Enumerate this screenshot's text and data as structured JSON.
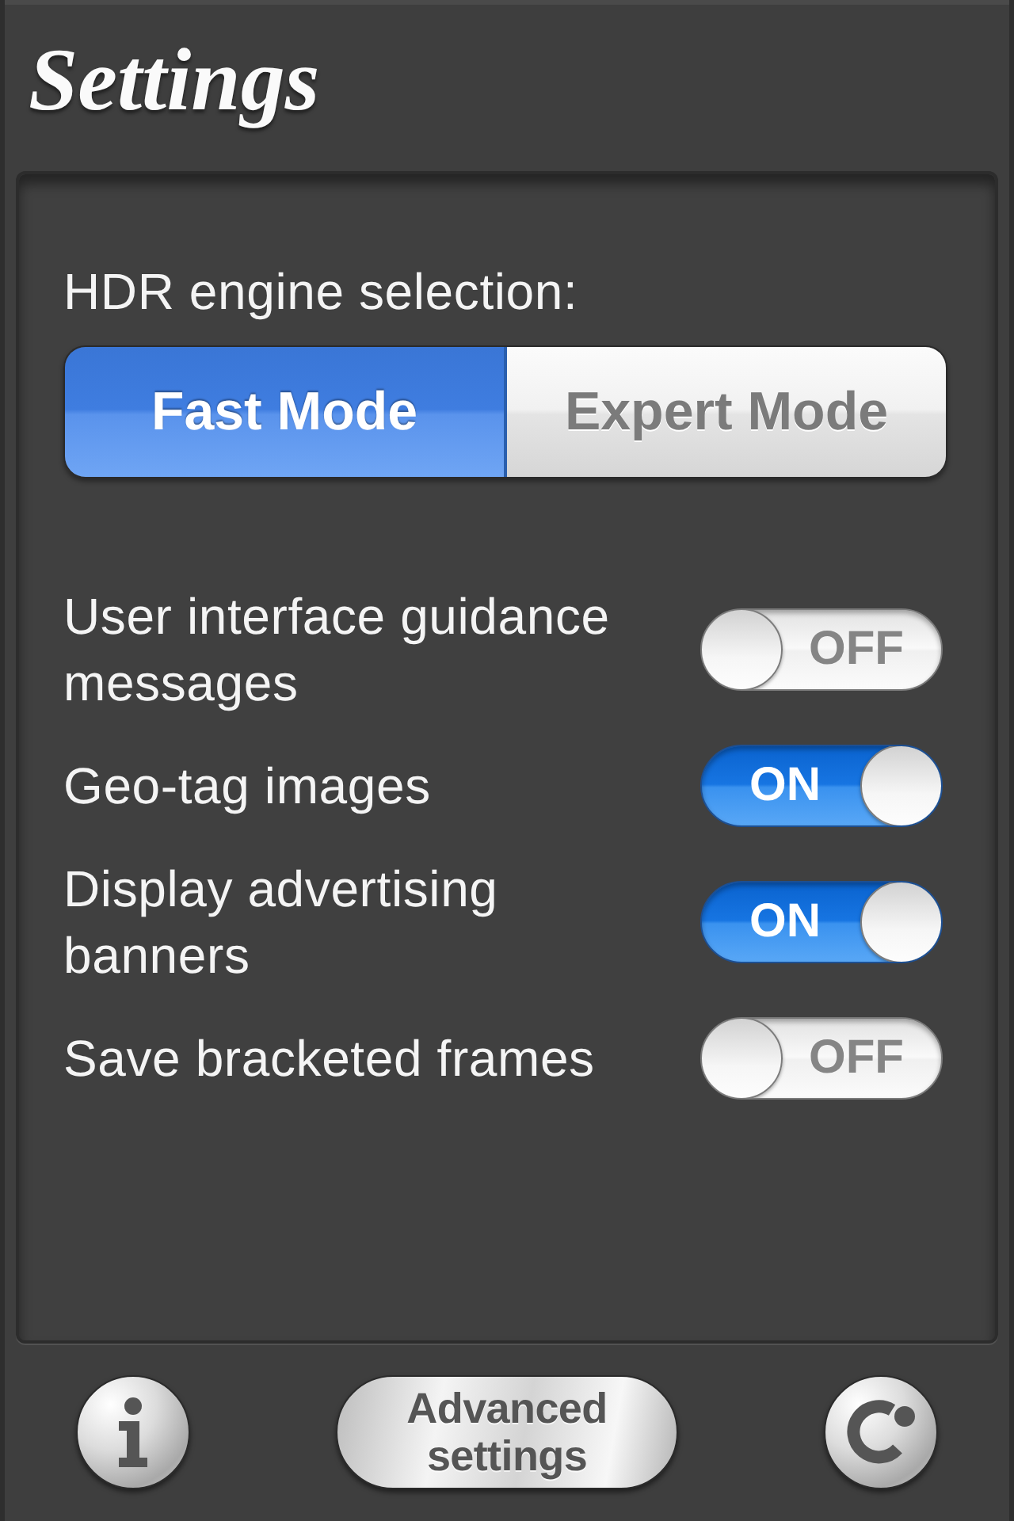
{
  "header": {
    "title": "Settings"
  },
  "engine": {
    "label": "HDR engine selection:",
    "options": [
      {
        "label": "Fast Mode",
        "selected": true
      },
      {
        "label": "Expert Mode",
        "selected": false
      }
    ]
  },
  "toggles": [
    {
      "label": "User interface guidance messages",
      "on": false,
      "state_text": "OFF"
    },
    {
      "label": "Geo-tag images",
      "on": true,
      "state_text": "ON"
    },
    {
      "label": "Display advertising banners",
      "on": true,
      "state_text": "ON"
    },
    {
      "label": "Save bracketed frames",
      "on": false,
      "state_text": "OFF"
    }
  ],
  "footer": {
    "advanced_button": "Advanced settings"
  }
}
